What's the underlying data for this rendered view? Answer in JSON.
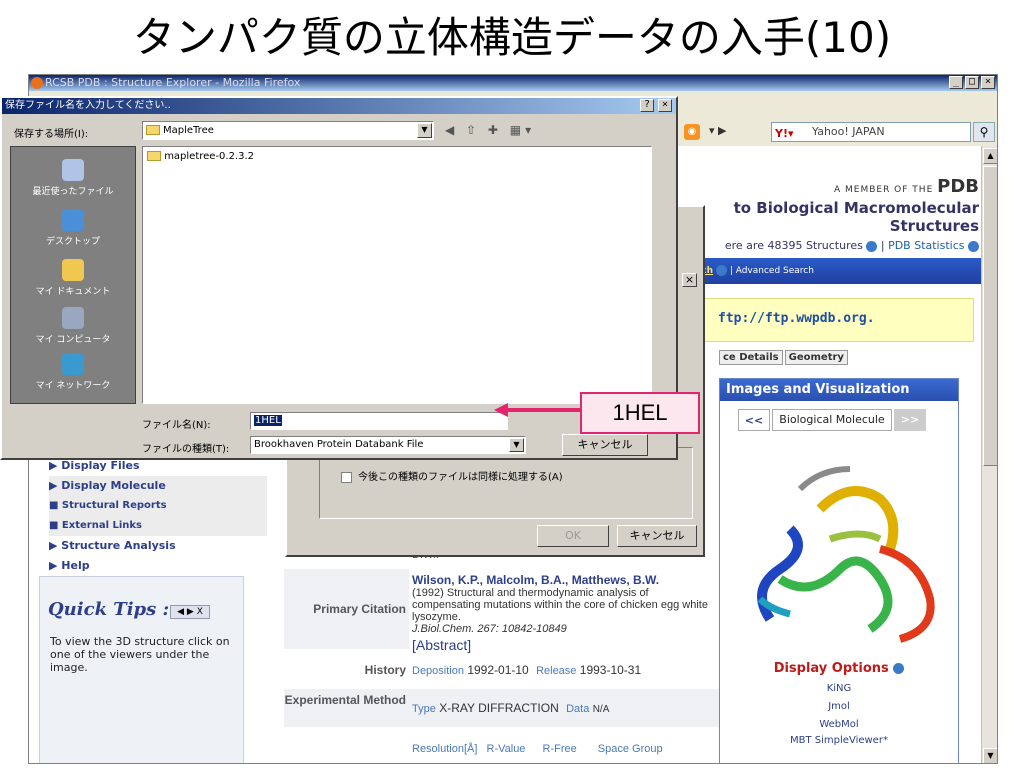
{
  "slide": {
    "title": "タンパク質の立体構造データの入手(10)"
  },
  "firefox": {
    "title": "RCSB PDB : Structure Explorer - Mozilla Firefox",
    "search_engine": "Yahoo! JAPAN"
  },
  "pdb": {
    "member": "A MEMBER OF THE",
    "logo": "PDB",
    "tagline": "to Biological Macromolecular Structures",
    "count_text": "ere are 48395 Structures",
    "stats_link": "PDB Statistics",
    "simple_search": "e Search",
    "advanced_search": "| Advanced Search",
    "ftp": "ftp://ftp.wwpdb.org.",
    "tab1": "ce Details",
    "tab2": "Geometry"
  },
  "sidebar": {
    "items": [
      {
        "label": "▶ Display Files"
      },
      {
        "label": "▶ Display Molecule"
      },
      {
        "label": "■ Structural Reports"
      },
      {
        "label": "■ External Links"
      },
      {
        "label": "▶ Structure Analysis"
      },
      {
        "label": "▶ Help"
      }
    ]
  },
  "quick_tips": {
    "title": "Quick Tips :",
    "nav": "◀ ▶ X",
    "text": "To view the 3D structure click on one of the viewers under the image."
  },
  "content": {
    "authors_partial": "D.W.:",
    "primary_citation_label": "Primary Citation",
    "authors": "Wilson, K.P., Malcolm, B.A., Matthews, B.W.",
    "citation": "(1992) Structural and thermodynamic analysis of compensating mutations within the core of chicken egg white lysozyme.",
    "journal": "J.Biol.Chem. 267: 10842-10849",
    "abstract": "[Abstract]",
    "history_label": "History",
    "deposition_label": "Deposition",
    "deposition": "1992-01-10",
    "release_label": "Release",
    "release": "1993-10-31",
    "method_label": "Experimental Method",
    "type_label": "Type",
    "type_value": "X-RAY DIFFRACTION",
    "data_label": "Data",
    "data_value": "N/A",
    "resolution": "Resolution[Å]",
    "rvalue": "R-Value",
    "rfree": "R-Free",
    "spacegroup": "Space Group"
  },
  "images_panel": {
    "title": "Images and Visualization",
    "prev": "<<",
    "next": ">>",
    "molecule": "Biological Molecule",
    "display_title": "Display Options",
    "options": [
      "KiNG",
      "Jmol",
      "WebMol",
      "MBT SimpleViewer*"
    ]
  },
  "dialog_open": {
    "checkbox": "今後この種類のファイルは同様に処理する(A)",
    "ok": "OK",
    "cancel": "キャンセル"
  },
  "save_dialog": {
    "title": "保存ファイル名を入力してください..",
    "lookin_label": "保存する場所(I):",
    "lookin_value": "MapleTree",
    "places": [
      "最近使ったファイル",
      "デスクトップ",
      "マイ ドキュメント",
      "マイ コンピュータ",
      "マイ ネットワーク"
    ],
    "files": [
      "mapletree-0.2.3.2"
    ],
    "filename_label": "ファイル名(N):",
    "filename_value": "1HEL",
    "filetype_label": "ファイルの種類(T):",
    "filetype_value": "Brookhaven Protein Databank File",
    "cancel": "キャンセル"
  },
  "callout": {
    "text": "1HEL",
    "color": "#e3246f"
  }
}
